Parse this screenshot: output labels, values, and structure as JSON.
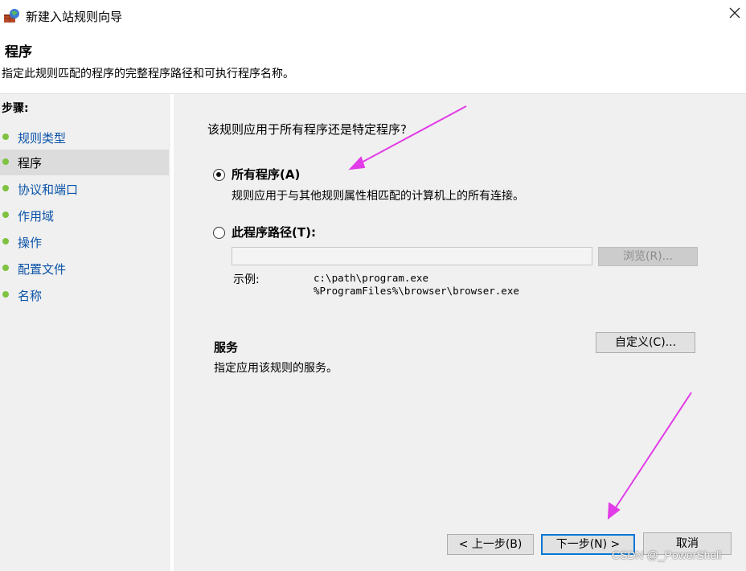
{
  "window": {
    "title": "新建入站规则向导",
    "close_glyph": "×"
  },
  "header": {
    "heading": "程序",
    "description": "指定此规则匹配的程序的完整程序路径和可执行程序名称。"
  },
  "sidebar": {
    "steps_title": "步骤:",
    "items": [
      {
        "label": "规则类型",
        "state": "link"
      },
      {
        "label": "程序",
        "state": "active"
      },
      {
        "label": "协议和端口",
        "state": "link"
      },
      {
        "label": "作用域",
        "state": "link"
      },
      {
        "label": "操作",
        "state": "link"
      },
      {
        "label": "配置文件",
        "state": "link"
      },
      {
        "label": "名称",
        "state": "link"
      }
    ]
  },
  "main": {
    "question": "该规则应用于所有程序还是特定程序?",
    "option_all": {
      "label": "所有程序(A)",
      "description": "规则应用于与其他规则属性相匹配的计算机上的所有连接。",
      "checked": true
    },
    "option_path": {
      "label": "此程序路径(T):",
      "checked": false,
      "value": ""
    },
    "browse_label": "浏览(R)...",
    "example_label": "示例:",
    "example_lines": [
      "c:\\path\\program.exe",
      "%ProgramFiles%\\browser\\browser.exe"
    ],
    "services": {
      "title": "服务",
      "description": "指定应用该规则的服务。",
      "customize_label": "自定义(C)..."
    }
  },
  "footer": {
    "back_label": "< 上一步(B)",
    "next_label": "下一步(N) >",
    "cancel_label": "取消"
  },
  "watermark": "CSDN @_PowerShell",
  "colors": {
    "accent": "#0078d7",
    "step_dot": "#7fc241",
    "link_text": "#0b53a8",
    "annotation_arrow": "#e23be8"
  },
  "icons": {
    "title": "firewall-icon",
    "close": "close-icon"
  }
}
